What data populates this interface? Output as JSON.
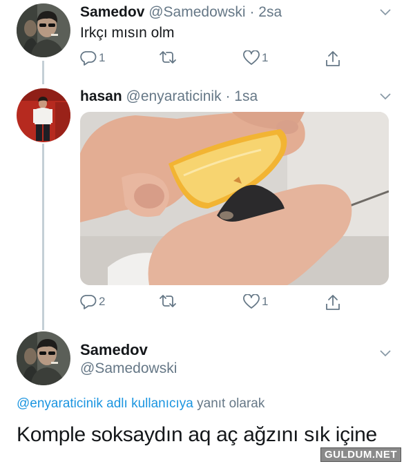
{
  "tweet1": {
    "name": "Samedov",
    "handle": "@Samedowski",
    "separator": "·",
    "time": "2sa",
    "text": "Irkçı mısın olm",
    "reply_count": "1",
    "retweet_count": "",
    "like_count": "1"
  },
  "tweet2": {
    "name": "hasan",
    "handle": "@enyaraticinik",
    "separator": "·",
    "time": "1sa",
    "reply_count": "2",
    "retweet_count": "",
    "like_count": "1"
  },
  "tweet3": {
    "name": "Samedov",
    "handle": "@Samedowski",
    "reply_mention": "@enyaraticinik adlı kullanıcıya",
    "reply_suffix": "yanıt olarak",
    "text": "Komple soksaydın aq aç ağzını sık içine"
  },
  "watermark": "GULDUM.NET",
  "colors": {
    "text": "#14171a",
    "secondary": "#657786",
    "link": "#1b95e0",
    "thread_line": "#c4cfd6"
  }
}
